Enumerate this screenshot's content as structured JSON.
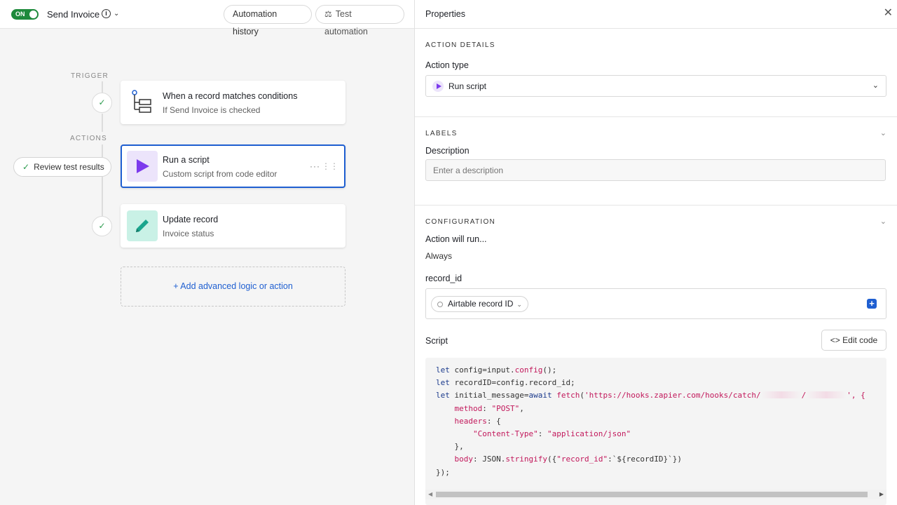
{
  "topbar": {
    "toggle_label": "ON",
    "automation_name": "Send Invoice",
    "history_btn": "Automation history",
    "test_btn": "Test automation"
  },
  "canvas": {
    "trigger_label": "TRIGGER",
    "actions_label": "ACTIONS",
    "trigger_card": {
      "title": "When a record matches conditions",
      "subtitle": "If Send Invoice is checked"
    },
    "action_cards": [
      {
        "title": "Run a script",
        "subtitle": "Custom script from code editor",
        "accent": "#7c3aed"
      },
      {
        "title": "Update record",
        "subtitle": "Invoice status",
        "accent": "#1aa58d"
      }
    ],
    "review_btn": "Review test results",
    "add_action": "Add advanced logic or action"
  },
  "properties": {
    "title": "Properties",
    "action_details": {
      "section_title": "ACTION DETAILS",
      "action_type_label": "Action type",
      "action_type_value": "Run script"
    },
    "labels": {
      "section_title": "LABELS",
      "description_label": "Description",
      "description_placeholder": "Enter a description"
    },
    "configuration": {
      "section_title": "CONFIGURATION",
      "run_label": "Action will run...",
      "run_value": "Always",
      "record_id_label": "record_id",
      "record_id_token": "Airtable record ID",
      "script_label": "Script",
      "edit_code_btn": "Edit code",
      "code": {
        "l1": [
          "let",
          " config=input.",
          "config",
          "();"
        ],
        "l2": [
          "let",
          " recordID=config.record_id;"
        ],
        "l3": [
          "let",
          " initial_message=",
          "await",
          " ",
          "fetch",
          "(",
          "'https://hooks.zapier.com/hooks/catch/",
          "/",
          "', {"
        ],
        "l4": [
          "method",
          ": ",
          "\"POST\"",
          ","
        ],
        "l5": [
          "headers",
          ": {"
        ],
        "l6": [
          "\"Content-Type\"",
          ": ",
          "\"application/json\""
        ],
        "l7": [
          "},"
        ],
        "l8": [
          "body",
          ": JSON.",
          "stringify",
          "({",
          "\"record_id\"",
          ":`${recordID}`})"
        ],
        "l9": [
          "});"
        ]
      }
    }
  },
  "colors": {
    "accent_blue": "#1f5fd1",
    "toggle_green": "#1e8a3c",
    "script_purple": "#7c3aed",
    "update_teal": "#1aa58d"
  }
}
